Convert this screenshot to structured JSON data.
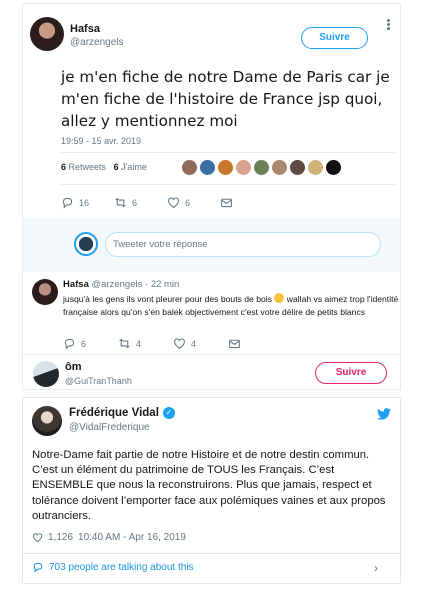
{
  "tweet": {
    "name": "Hafsa",
    "handle": "@arzengels",
    "follow_label": "Suivre",
    "text": "je m'en fiche de notre Dame de Paris car je m'en fiche de l'histoire de France jsp quoi, allez y mentionnez moi",
    "time": "19:59 - 15 avr. 2019",
    "retweets_count": "6",
    "retweets_label": "Retweets",
    "likes_count": "6",
    "likes_label": "J'aime",
    "actions": {
      "replies": "16",
      "retweets": "6",
      "likes": "6"
    },
    "liker_colors": [
      "#8e6b5a",
      "#3a6ea5",
      "#c9772b",
      "#d8a48f",
      "#6b7f59",
      "#a8896f",
      "#5d4b45",
      "#cfb47a",
      "#111111"
    ]
  },
  "reply_box": {
    "placeholder": "Tweeter votre réponse"
  },
  "reply": {
    "name": "Hafsa",
    "handle": "@arzengels",
    "age": "22 min",
    "text_part1": "jusqu'à les gens ils vont pleurer pour des bouts de bois",
    "text_part2": "wallah vs aimez trop l'identité française alors qu'on s'en balek objectivement c'est votre délire de petits blancs",
    "actions": {
      "replies": "6",
      "retweets": "4",
      "likes": "4"
    }
  },
  "suggested_user": {
    "name": "ôm",
    "handle": "@GuiTranThanh",
    "follow_label": "Suivre"
  },
  "embed": {
    "name": "Frédérique Vidal",
    "handle": "@VidalFrederique",
    "text": "Notre-Dame fait partie de notre Histoire et de notre destin commun. C’est un élément du patrimoine de TOUS les Français. C’est ENSEMBLE que nous la reconstruirons. Plus que jamais, respect et tolérance doivent l’emporter face aux polémiques vaines et aux propos outranciers.",
    "likes": "1,126",
    "timestamp": "10:40 AM - Apr 16, 2019",
    "talking": "703 people are talking about this"
  },
  "colors": {
    "twitter_blue": "#1da1f2",
    "follow_red": "#e0245e",
    "muted": "#657786"
  }
}
